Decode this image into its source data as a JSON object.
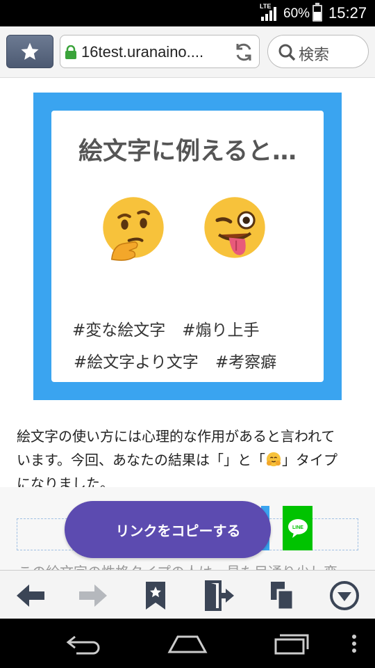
{
  "status": {
    "network": "LTE",
    "battery_percent_label": "60%",
    "battery_level": 0.6,
    "time": "15:27"
  },
  "toolbar": {
    "bookmark_icon": "star-icon",
    "url": "16test.uranaino....",
    "search_placeholder": "検索"
  },
  "card": {
    "title": "絵文字に例えると…",
    "emojis": [
      "thinking-face",
      "winking-face-with-tongue"
    ],
    "tags_row1": [
      "#変な絵文字",
      "#煽り上手"
    ],
    "tags_row2": [
      "#絵文字より文字",
      "#考察癖"
    ]
  },
  "content": {
    "para_line1": "絵文字の使い方には心理的な作用があると言われて",
    "para_line2_a": "います。今回、あなたの結果は「",
    "para_line2_b": "」と「",
    "para_line2_c": "」タイプ",
    "para_line3": "になりました。",
    "cut_text": "この絵文字の性格タイプの人は、見た目通り少し変"
  },
  "share": {
    "copy_label": "リンクをコピーする",
    "line_label": "LINE"
  },
  "colors": {
    "card_border": "#3aa4f0",
    "copy_button": "#5c4bb0",
    "line_green": "#00c300"
  }
}
